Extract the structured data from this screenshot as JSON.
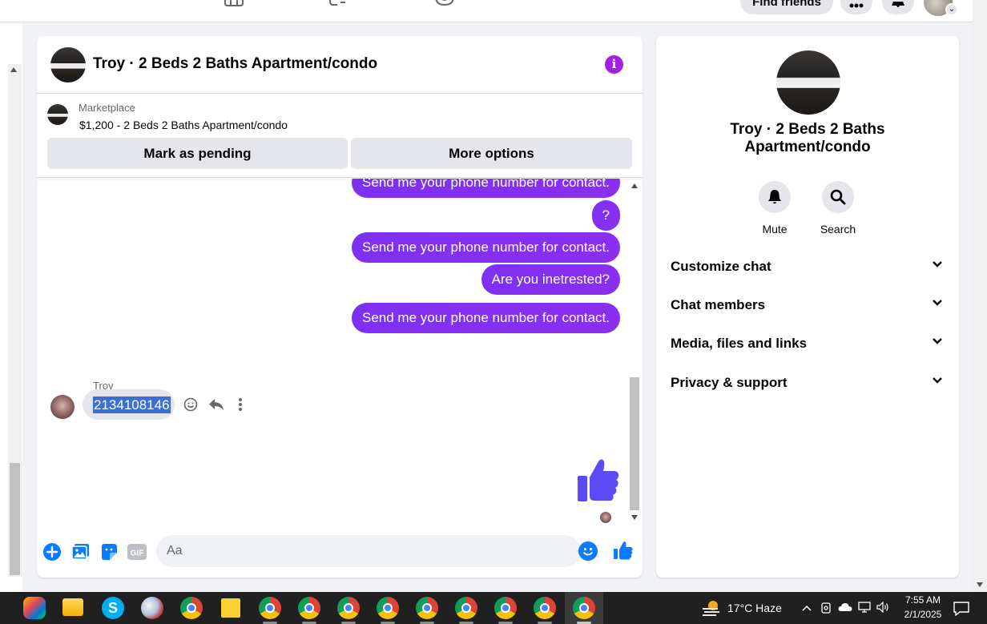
{
  "topbar": {
    "find_friends_label": "Find friends"
  },
  "chat": {
    "title": "Troy · 2 Beds 2 Baths Apartment/condo",
    "marketplace": {
      "label": "Marketplace",
      "listing": "$1,200 - 2 Beds 2 Baths Apartment/condo",
      "mark_pending_label": "Mark as pending",
      "more_options_label": "More options"
    },
    "outgoing_messages": [
      "Send me your phone number for contact.",
      "?",
      "Send me your phone number for contact.",
      "Are you inetrested?",
      "Send me your phone number for contact."
    ],
    "incoming": {
      "sender": "Troy",
      "text": "2134108146"
    },
    "composer": {
      "placeholder": "Aa",
      "icons": [
        "plus-icon",
        "photo-icon",
        "sticker-icon",
        "gif-icon",
        "emoji-icon",
        "like-icon"
      ],
      "gif_label": "GIF"
    }
  },
  "info_panel": {
    "name": "Troy · 2 Beds 2 Baths Apartment/condo",
    "actions": [
      {
        "label": "Mute",
        "icon": "bell-icon"
      },
      {
        "label": "Search",
        "icon": "search-icon"
      }
    ],
    "sections": [
      "Customize chat",
      "Chat members",
      "Media, files and links",
      "Privacy & support"
    ]
  },
  "taskbar": {
    "weather": "17°C  Haze",
    "time": "7:55 AM",
    "date": "2/1/2025"
  },
  "colors": {
    "accent_purple": "#7e30f2",
    "info_icon": "#a21fe6",
    "messenger_blue": "#0a7cff",
    "like_blue": "#4f46e5"
  }
}
